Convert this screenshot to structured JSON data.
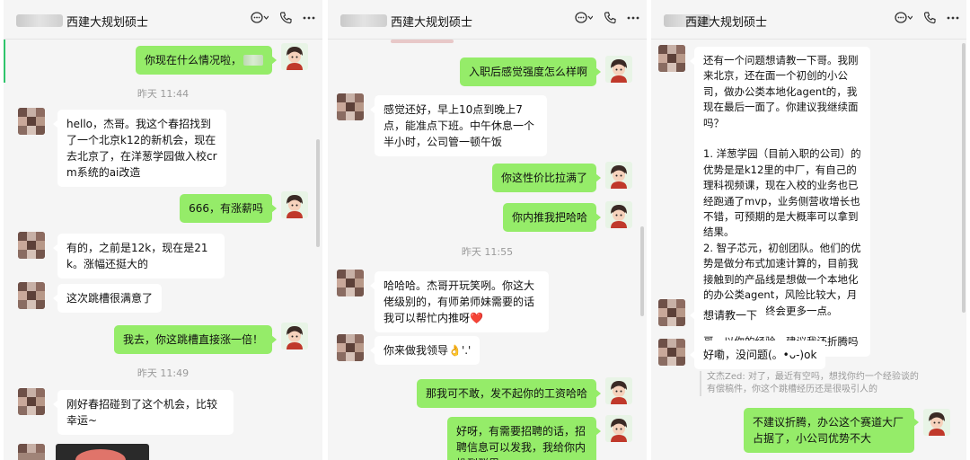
{
  "colors": {
    "sent_bubble": "#95ec69",
    "received_bubble": "#ffffff",
    "panel_bg": "#f5f5f5",
    "accent": "#2fc56b"
  },
  "header": {
    "title": "西建大规划硕士",
    "icons": [
      "chat-bubble-icon",
      "phone-icon",
      "more-icon"
    ]
  },
  "panel1": {
    "messages": [
      {
        "from": "me",
        "text": "你现在什么情况啦，"
      },
      {
        "type": "time",
        "text": "昨天 11:44"
      },
      {
        "from": "other",
        "text": "hello，杰哥。我这个春招找到了一个北京k12的新机会，现在去北京了，在洋葱学园做入校crm系统的ai改造"
      },
      {
        "from": "me",
        "text": "666，有涨薪吗"
      },
      {
        "from": "other",
        "text": "有的，之前是12k，现在是21k。涨幅还挺大的"
      },
      {
        "from": "other",
        "text": "这次跳槽很满意了"
      },
      {
        "from": "me",
        "text": "我去，你这跳槽直接涨一倍！"
      },
      {
        "type": "time",
        "text": "昨天 11:49"
      },
      {
        "from": "other",
        "text": "刚好春招碰到了这个机会，比较幸运~"
      }
    ]
  },
  "panel2": {
    "messages": [
      {
        "from": "me",
        "text": "入职后感觉强度怎么样啊"
      },
      {
        "from": "other",
        "text": "感觉还好，早上10点到晚上7点，能准点下班。中午休息一个半小时，公司管一顿午饭"
      },
      {
        "from": "me",
        "text": "你这性价比拉满了"
      },
      {
        "from": "me",
        "text": "你内推我把哈哈"
      },
      {
        "type": "time",
        "text": "昨天 11:55"
      },
      {
        "from": "other",
        "text": "哈哈哈。杰哥开玩笑咧。你这大佬级别的，有师弟师妹需要的话我可以帮忙内推呀❤️"
      },
      {
        "from": "other",
        "text": "你来做我领导👌'.'"
      },
      {
        "from": "me",
        "text": "那我可不敢，发不起你的工资哈哈"
      },
      {
        "from": "me",
        "text": "好呀，有需要招聘的话，招聘信息可以发我，我给你内推到群里"
      }
    ]
  },
  "panel3": {
    "messages": [
      {
        "from": "other",
        "text": "还有一个问题想请教一下哥。我刚来北京，还在面一个初创的小公司，做办公类本地化agent的，我现在最后一面了。你建议我继续面吗？\n\n1. 洋葱学园（目前入职的公司）的优势是是k12里的中厂，有自己的理科视频课，现在入校的业务也已经跑通了mvp，业务侧营收增长也不错，可预期的是大概率可以拿到结果。\n2. 智子芯元，初创团队。他们的优势是做分布式加速计算的，目前我接触到的产品线是想做一个本地化的办公类agent，风险比较大，月薪差不多，年终会更多一点。\n\n哥，以你的经验。建议我还折腾吗"
      },
      {
        "from": "other",
        "text": "想请教一下"
      },
      {
        "from": "other",
        "text": "好嘞，没问题(。•ᴗ-)ok"
      },
      {
        "type": "quote",
        "text": "文杰Zed: 对了，最近有空吗，想找你约一个经验谈的有偿稿件，你这个跳槽经历还是很吸引人的"
      },
      {
        "from": "me",
        "text": "不建议折腾，办公这个赛道大厂占据了，小公司优势不大"
      }
    ]
  }
}
